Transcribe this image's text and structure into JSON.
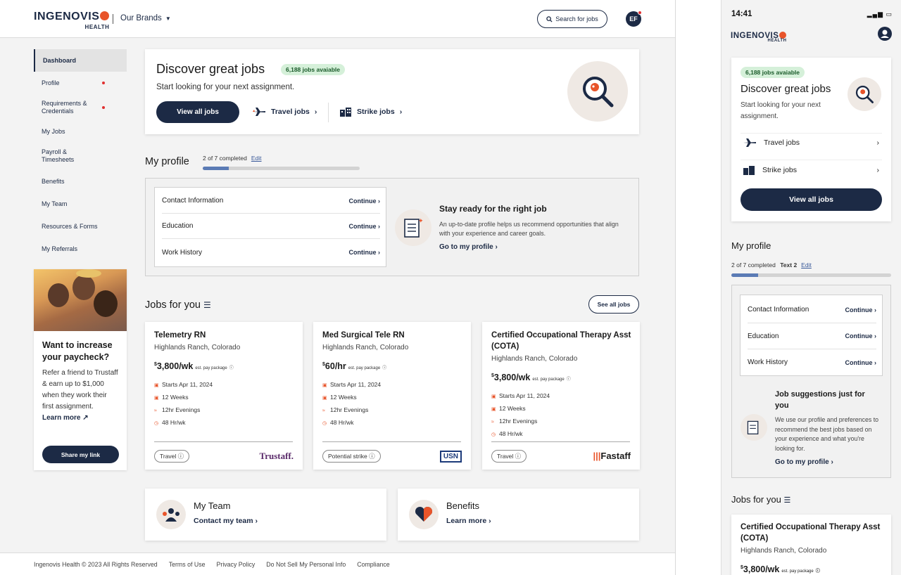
{
  "header": {
    "logo_text": "INGENOVIS",
    "logo_sub": "HEALTH",
    "brands_label": "Our Brands",
    "search_label": "Search for jobs",
    "avatar_initials": "EF"
  },
  "sidebar": {
    "items": [
      {
        "label": "Dashboard",
        "active": true
      },
      {
        "label": "Profile",
        "dot": true
      },
      {
        "label": "Requirements & Credentials",
        "dot": true
      },
      {
        "label": "My Jobs"
      },
      {
        "label": "Payroll & Timesheets"
      },
      {
        "label": "Benefits"
      },
      {
        "label": "My Team"
      },
      {
        "label": "Resources & Forms"
      },
      {
        "label": "My Referrals"
      }
    ]
  },
  "promo": {
    "title": "Want to increase your paycheck?",
    "body": "Refer a friend to Trustaff & earn up to $1,000 when they work their first assignment.",
    "learn_more": "Learn more",
    "share_button": "Share my link"
  },
  "hero": {
    "title": "Discover great jobs",
    "badge": "6,188 jobs avaiable",
    "subtitle": "Start looking for your next assignment.",
    "view_all": "View all jobs",
    "travel": "Travel jobs",
    "strike": "Strike jobs"
  },
  "profile": {
    "title": "My profile",
    "progress_text": "2 of 7 completed",
    "progress_fraction": 0.1667,
    "edit": "Edit",
    "rows": [
      {
        "label": "Contact Information",
        "action": "Continue"
      },
      {
        "label": "Education",
        "action": "Continue"
      },
      {
        "label": "Work History",
        "action": "Continue"
      }
    ],
    "stay_title": "Stay ready for the right job",
    "stay_body": "An up-to-date profile helps us recommend opportunities that align with your experience and career goals.",
    "go_link": "Go to my profile"
  },
  "jobs": {
    "title": "Jobs for you",
    "see_all": "See all jobs",
    "cards": [
      {
        "title": "Telemetry RN",
        "location": "Highlands Ranch, Colorado",
        "pay": "3,800",
        "pay_unit": "/wk",
        "pay_note": "est. pay package",
        "start": "Starts Apr 11, 2024",
        "weeks": "12 Weeks",
        "shift": "12hr Evenings",
        "hours": "48 Hr/wk",
        "tag": "Travel",
        "brand": "Trustaff."
      },
      {
        "title": "Med Surgical Tele RN",
        "location": "Highlands Ranch, Colorado",
        "pay": "60",
        "pay_unit": "/hr",
        "pay_note": "est. pay package",
        "start": "Starts Apr 11, 2024",
        "weeks": "12 Weeks",
        "shift": "12hr Evenings",
        "hours": "48 Hr/wk",
        "tag": "Potential strike",
        "brand": "USN"
      },
      {
        "title": "Certified Occupational Therapy Asst (COTA)",
        "location": "Highlands Ranch, Colorado",
        "pay": "3,800",
        "pay_unit": "/wk",
        "pay_note": "est. pay package",
        "start": "Starts Apr 11, 2024",
        "weeks": "12 Weeks",
        "shift": "12hr Evenings",
        "hours": "48 Hr/wk",
        "tag": "Travel",
        "brand": "Fastaff"
      }
    ]
  },
  "team": {
    "title": "My Team",
    "link": "Contact my team"
  },
  "benefits": {
    "title": "Benefits",
    "link": "Learn more"
  },
  "footer": {
    "copyright": "Ingenovis Health © 2023 All Rights Reserved",
    "links": [
      "Terms of Use",
      "Privacy Policy",
      "Do Not Sell My Personal Info",
      "Compliance"
    ]
  },
  "mobile": {
    "time": "14:41",
    "badge": "6,188 jobs avaiable",
    "hero_title": "Discover great jobs",
    "hero_sub": "Start looking for your next assignment.",
    "travel": "Travel jobs",
    "strike": "Strike jobs",
    "view_all": "View all jobs",
    "profile_title": "My profile",
    "progress_text": "2 of 7 completed",
    "progress_extra": "Text 2",
    "edit": "Edit",
    "rows": [
      {
        "label": "Contact Information",
        "action": "Continue"
      },
      {
        "label": "Education",
        "action": "Continue"
      },
      {
        "label": "Work History",
        "action": "Continue"
      }
    ],
    "sugg_title": "Job suggestions just for you",
    "sugg_body": "We use our profile and preferences to recommend the best jobs based on your experience and what you're looking for.",
    "go_link": "Go to my profile",
    "jobs_title": "Jobs for you",
    "job_title": "Certified Occupational Therapy Asst (COTA)",
    "job_location": "Highlands Ranch, Colorado",
    "job_pay": "3,800",
    "job_pay_unit": "/wk",
    "job_pay_note": "est. pay package"
  },
  "colors": {
    "navy": "#1c2a45",
    "accent": "#e8542a",
    "badge_bg": "#d5f0d9",
    "progress": "#5b7bb5"
  }
}
